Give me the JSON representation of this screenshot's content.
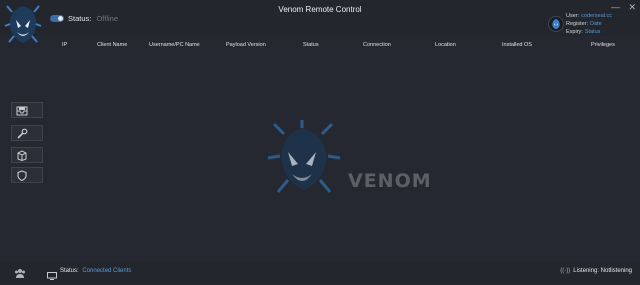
{
  "app": {
    "title": "Venom Remote Control"
  },
  "header": {
    "status_label": "Status:",
    "status_value": "Offline",
    "window_controls": {
      "minimize": "—",
      "close": "✕"
    },
    "user": {
      "user_label": "User:",
      "user_value": "coderseal.cc",
      "register_label": "Register:",
      "register_value": "Date",
      "expiry_label": "Expiry:",
      "expiry_value": "Status"
    }
  },
  "table": {
    "columns": [
      "IP",
      "Client Name",
      "Username/PC Name",
      "Payload Version",
      "Status",
      "Connection",
      "Location",
      "Installed OS",
      "Privileges"
    ]
  },
  "sidebar": {
    "items": [
      {
        "icon": "inbox-icon"
      },
      {
        "icon": "wrench-icon"
      },
      {
        "icon": "box-icon"
      },
      {
        "icon": "shield-icon"
      }
    ]
  },
  "watermark": {
    "text": "VENOM"
  },
  "footer": {
    "status_label": "Status:",
    "status_value": "Connected Clients",
    "listening_icon": "signal-icon",
    "listening_text": "Listening: Notlistening"
  },
  "colors": {
    "accent": "#5a9bd8",
    "background": "#252830",
    "bar": "#23262d"
  }
}
